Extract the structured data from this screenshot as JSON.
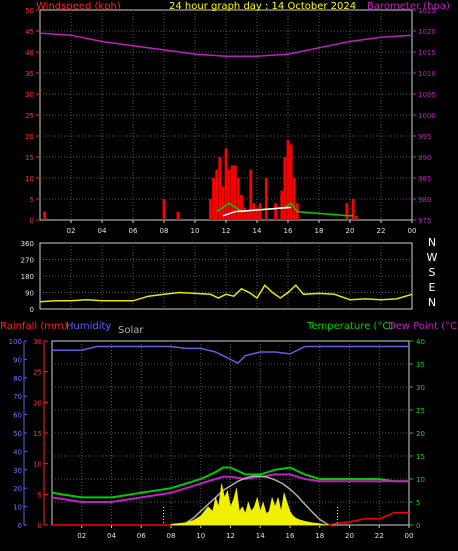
{
  "chart_data": [
    {
      "type": "line",
      "title": "24 hour graph day : 14 October 2024",
      "ylabel_left": "Windspeed (kph)",
      "ylabel_right": "Barometer (hpa)",
      "x_ticks": [
        "02",
        "04",
        "06",
        "08",
        "10",
        "12",
        "14",
        "16",
        "18",
        "20",
        "22",
        "00"
      ],
      "ylim_left": [
        0,
        50
      ],
      "yticks_left": [
        "0",
        "5",
        "10",
        "15",
        "20",
        "25",
        "30",
        "35",
        "40",
        "45",
        "50"
      ],
      "ylim_right": [
        975,
        1025
      ],
      "yticks_right": [
        "975",
        "980",
        "985",
        "990",
        "995",
        "1000",
        "1005",
        "1010",
        "1015",
        "1020",
        "1025"
      ],
      "grid": true,
      "series": [
        {
          "name": "Windspeed (kph)",
          "axis": "left",
          "color": "#ff0000",
          "style": "bars",
          "x": [
            0.3,
            8.0,
            8.9,
            11.0,
            11.2,
            11.4,
            11.6,
            11.8,
            12.0,
            12.2,
            12.4,
            12.6,
            12.8,
            13.0,
            13.2,
            13.4,
            13.6,
            13.8,
            14.0,
            14.2,
            14.6,
            15.2,
            15.6,
            15.8,
            16.0,
            16.2,
            16.4,
            16.6,
            19.8,
            20.2,
            20.4
          ],
          "y": [
            2,
            5,
            2,
            5,
            10,
            12,
            15,
            8,
            17,
            12,
            13,
            13,
            10,
            6,
            3,
            2,
            12,
            4,
            3,
            4,
            10,
            4,
            7,
            15,
            19,
            18,
            10,
            4,
            4,
            5,
            1
          ]
        },
        {
          "name": "Wind gust (green)",
          "axis": "left",
          "color": "#00cc00",
          "style": "line",
          "x": [
            11.4,
            11.8,
            12.2,
            12.6,
            13.0,
            15.8,
            16.2,
            16.6,
            19.9,
            20.2
          ],
          "y": [
            2,
            3,
            4,
            3,
            2,
            3,
            4,
            2,
            1,
            1
          ]
        },
        {
          "name": "Wind average (white)",
          "axis": "left",
          "color": "#ffffff",
          "style": "line",
          "x": [
            11.8,
            12.6,
            16.2
          ],
          "y": [
            1,
            2,
            3
          ]
        },
        {
          "name": "Barometer (hpa)",
          "axis": "right",
          "color": "#c020c0",
          "style": "line",
          "x": [
            0,
            2,
            4,
            6,
            8,
            10,
            12,
            14,
            16,
            18,
            20,
            22,
            24
          ],
          "y": [
            1019.5,
            1019.0,
            1017.5,
            1016.5,
            1015.5,
            1014.5,
            1014.0,
            1014.0,
            1014.5,
            1016.0,
            1017.5,
            1018.5,
            1019.0
          ]
        }
      ]
    },
    {
      "type": "line",
      "x_ticks": [
        "02",
        "04",
        "06",
        "08",
        "10",
        "12",
        "14",
        "16",
        "18",
        "20",
        "22",
        "00"
      ],
      "ylim": [
        0,
        360
      ],
      "yticks": [
        "0",
        "90",
        "180",
        "270",
        "360"
      ],
      "direction_labels": [
        "N",
        "W",
        "S",
        "E",
        "N"
      ],
      "grid": true,
      "series": [
        {
          "name": "Wind direction",
          "color": "#e6e600",
          "x": [
            0,
            1,
            2,
            3,
            4,
            5,
            6,
            7,
            8,
            9,
            10,
            11,
            11.5,
            12,
            12.5,
            13,
            13.5,
            14,
            14.5,
            15,
            15.5,
            16,
            16.5,
            17,
            18,
            19,
            20,
            21,
            22,
            23,
            24
          ],
          "y": [
            40,
            45,
            45,
            50,
            45,
            45,
            45,
            70,
            80,
            90,
            85,
            80,
            60,
            80,
            70,
            110,
            90,
            60,
            130,
            90,
            60,
            90,
            130,
            80,
            85,
            80,
            50,
            55,
            50,
            55,
            80
          ]
        }
      ]
    },
    {
      "type": "line",
      "ylabel_left_1": "Rainfall (mm)",
      "ylabel_left_2": "Humidity",
      "label_solar": "Solar",
      "ylabel_right_1": "Temperature (°C)",
      "ylabel_right_2": "Dew Point (°C)",
      "x_ticks": [
        "02",
        "04",
        "06",
        "08",
        "10",
        "12",
        "14",
        "16",
        "18",
        "20",
        "22",
        "00"
      ],
      "ylim_humidity": [
        0,
        100
      ],
      "yticks_humidity": [
        "0",
        "10",
        "20",
        "30",
        "40",
        "50",
        "60",
        "70",
        "80",
        "90",
        "100"
      ],
      "ylim_rain": [
        0,
        30
      ],
      "yticks_rain": [
        "0",
        "5",
        "10",
        "15",
        "20",
        "25",
        "30"
      ],
      "ylim_temp": [
        0,
        40
      ],
      "yticks_temp": [
        "0",
        "5",
        "10",
        "15",
        "20",
        "25",
        "30",
        "35",
        "40"
      ],
      "grid": true,
      "series": [
        {
          "name": "Humidity",
          "axis": "humidity",
          "color": "#6060e0",
          "x": [
            0,
            2,
            3,
            4,
            6,
            8,
            9,
            10,
            11,
            12,
            12.5,
            13,
            14,
            15,
            16,
            17,
            18,
            20,
            22,
            24
          ],
          "y": [
            95,
            95,
            97,
            97,
            97,
            97,
            96,
            96,
            94,
            90,
            88,
            92,
            94,
            94,
            93,
            97,
            97,
            97,
            97,
            97
          ]
        },
        {
          "name": "Rainfall (mm)",
          "axis": "rain",
          "color": "#ff0000",
          "x": [
            0,
            18.5,
            19,
            20,
            21,
            22,
            22.5,
            23,
            24
          ],
          "y": [
            0,
            0,
            0.2,
            0.5,
            1,
            1,
            1.5,
            2,
            2
          ]
        },
        {
          "name": "Temperature (°C)",
          "axis": "temp",
          "color": "#00cc00",
          "x": [
            0,
            1,
            2,
            3,
            4,
            5,
            6,
            7,
            8,
            9,
            10,
            11,
            11.5,
            12,
            13,
            14,
            15,
            16,
            17,
            18,
            19,
            20,
            21,
            22,
            23,
            24
          ],
          "y": [
            7,
            6.5,
            6,
            6,
            6,
            6.5,
            7,
            7.5,
            8,
            9,
            10,
            11.5,
            12.5,
            12.5,
            11,
            11,
            12,
            12.5,
            11,
            10,
            10,
            10,
            10,
            10,
            9.5,
            9.5
          ]
        },
        {
          "name": "Dew Point (°C)",
          "axis": "temp",
          "color": "#c020c0",
          "x": [
            0,
            1,
            2,
            3,
            4,
            5,
            6,
            7,
            8,
            9,
            10,
            11,
            11.5,
            12,
            13,
            14,
            15,
            16,
            17,
            18,
            19,
            20,
            21,
            22,
            23,
            24
          ],
          "y": [
            6,
            5.5,
            5,
            5,
            5,
            5.5,
            6,
            6.5,
            7,
            8,
            9,
            10,
            10.5,
            10.5,
            10,
            10.5,
            11,
            11,
            10,
            9.5,
            9.5,
            9.5,
            9.5,
            9.5,
            9.5,
            9.5
          ]
        },
        {
          "name": "Solar (grey)",
          "axis": "temp",
          "color": "#b0b0b0",
          "x": [
            8.8,
            9.5,
            10,
            10.5,
            11,
            11.5,
            12,
            12.5,
            13,
            13.5,
            14,
            14.5,
            15,
            15.5,
            16,
            16.5,
            17,
            17.5,
            18,
            18.6
          ],
          "y": [
            0,
            1.5,
            3,
            4.5,
            6,
            7.5,
            8.5,
            9.5,
            10.2,
            10.6,
            10.6,
            10.4,
            9.8,
            9,
            7.8,
            6.3,
            4.5,
            2.8,
            1.2,
            0
          ]
        },
        {
          "name": "Solar (yellow)",
          "axis": "temp",
          "color": "#f0f000",
          "x": [
            8,
            9,
            9.5,
            10,
            10.5,
            10.8,
            11,
            11.2,
            11.4,
            11.6,
            11.8,
            12,
            12.2,
            12.4,
            12.6,
            12.8,
            13,
            13.2,
            13.4,
            13.6,
            13.8,
            14,
            14.2,
            14.4,
            14.6,
            14.8,
            15,
            15.2,
            15.4,
            15.6,
            15.8,
            16,
            16.2,
            16.4,
            16.6,
            16.8,
            17,
            17.5,
            18,
            18.5
          ],
          "y": [
            0.2,
            0.5,
            1,
            2,
            4,
            3,
            6,
            4,
            9,
            6,
            7.5,
            4,
            5.5,
            8,
            3,
            4,
            2.5,
            5,
            3,
            4,
            6,
            3,
            5,
            2.5,
            3,
            6,
            4,
            6,
            3,
            7,
            5,
            3,
            2,
            1.5,
            1.2,
            1,
            0.8,
            0.5,
            0.3,
            0
          ]
        }
      ],
      "markers": [
        {
          "x": 7.5,
          "color": "#ffffff",
          "style": "dotted"
        },
        {
          "x": 19.2,
          "color": "#ffffff",
          "style": "dotted"
        }
      ]
    }
  ]
}
